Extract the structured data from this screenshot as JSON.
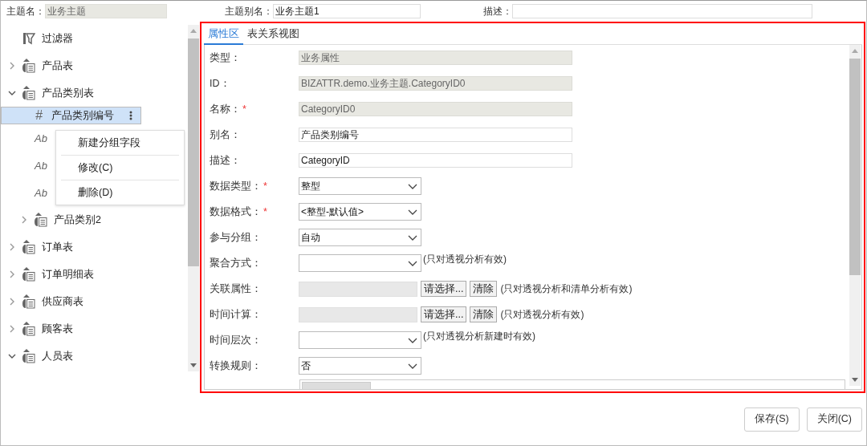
{
  "header": {
    "fields": [
      {
        "label": "主题名：",
        "value": "业务主题",
        "disabled": true
      },
      {
        "label": "主题别名：",
        "value": "业务主题1",
        "disabled": false
      },
      {
        "label": "描述：",
        "disabled": false
      }
    ]
  },
  "tree": {
    "items": [
      {
        "kind": "filter",
        "label": "过滤器"
      },
      {
        "kind": "table",
        "label": "产品表",
        "expanded": false
      },
      {
        "kind": "table",
        "label": "产品类别表",
        "expanded": true,
        "children": [
          {
            "kind": "number",
            "glyph": "#",
            "label": "产品类别编号",
            "selected": true
          },
          {
            "kind": "text",
            "glyph": "Ab",
            "selected": false
          },
          {
            "kind": "text",
            "glyph": "Ab",
            "selected": false
          },
          {
            "kind": "text",
            "glyph": "Ab",
            "selected": false
          },
          {
            "kind": "table",
            "label": "产品类别2",
            "expanded": false
          }
        ]
      },
      {
        "kind": "table",
        "label": "订单表",
        "expanded": false
      },
      {
        "kind": "table",
        "label": "订单明细表",
        "expanded": false
      },
      {
        "kind": "table",
        "label": "供应商表",
        "expanded": false
      },
      {
        "kind": "table",
        "label": "顾客表",
        "expanded": false
      },
      {
        "kind": "table",
        "label": "人员表",
        "expanded": true
      }
    ]
  },
  "context_menu": {
    "items": [
      "新建分组字段",
      "修改(C)",
      "删除(D)"
    ]
  },
  "tabs": [
    {
      "label": "属性区",
      "selected": true
    },
    {
      "label": "表关系视图",
      "selected": false
    }
  ],
  "form": {
    "rows": [
      {
        "kind": "text",
        "label": "类型：",
        "value": "业务属性",
        "disabled": true
      },
      {
        "kind": "text",
        "label": "ID：",
        "value": "BIZATTR.demo.业务主题.CategoryID0",
        "disabled": true
      },
      {
        "kind": "text",
        "label": "名称：",
        "required_mark": "*",
        "value": "CategoryID0",
        "disabled": true
      },
      {
        "kind": "text",
        "label": "别名：",
        "value": "产品类别编号",
        "disabled": false
      },
      {
        "kind": "text",
        "label": "描述：",
        "value": "CategoryID",
        "disabled": false
      },
      {
        "kind": "select",
        "label": "数据类型：",
        "required_mark": "*",
        "value": "整型"
      },
      {
        "kind": "select",
        "label": "数据格式：",
        "required_mark": "*",
        "value": "<整型-默认值>"
      },
      {
        "kind": "select",
        "label": "参与分组：",
        "value": "自动"
      },
      {
        "kind": "select",
        "label": "聚合方式：",
        "note": "(只对透视分析有效)"
      },
      {
        "kind": "picker",
        "label": "关联属性：",
        "buttons": [
          "请选择...",
          "清除"
        ],
        "note": "(只对透视分析和清单分析有效)"
      },
      {
        "kind": "picker",
        "label": "时间计算：",
        "buttons": [
          "请选择...",
          "清除"
        ],
        "note": "(只对透视分析有效)"
      },
      {
        "kind": "select",
        "label": "时间层次：",
        "note": "(只对透视分析新建时有效)"
      },
      {
        "kind": "select",
        "label": "转换规则：",
        "value": "否"
      },
      {
        "kind": "cutoff"
      }
    ]
  },
  "footer": {
    "buttons": [
      "保存(S)",
      "关闭(C)"
    ]
  }
}
